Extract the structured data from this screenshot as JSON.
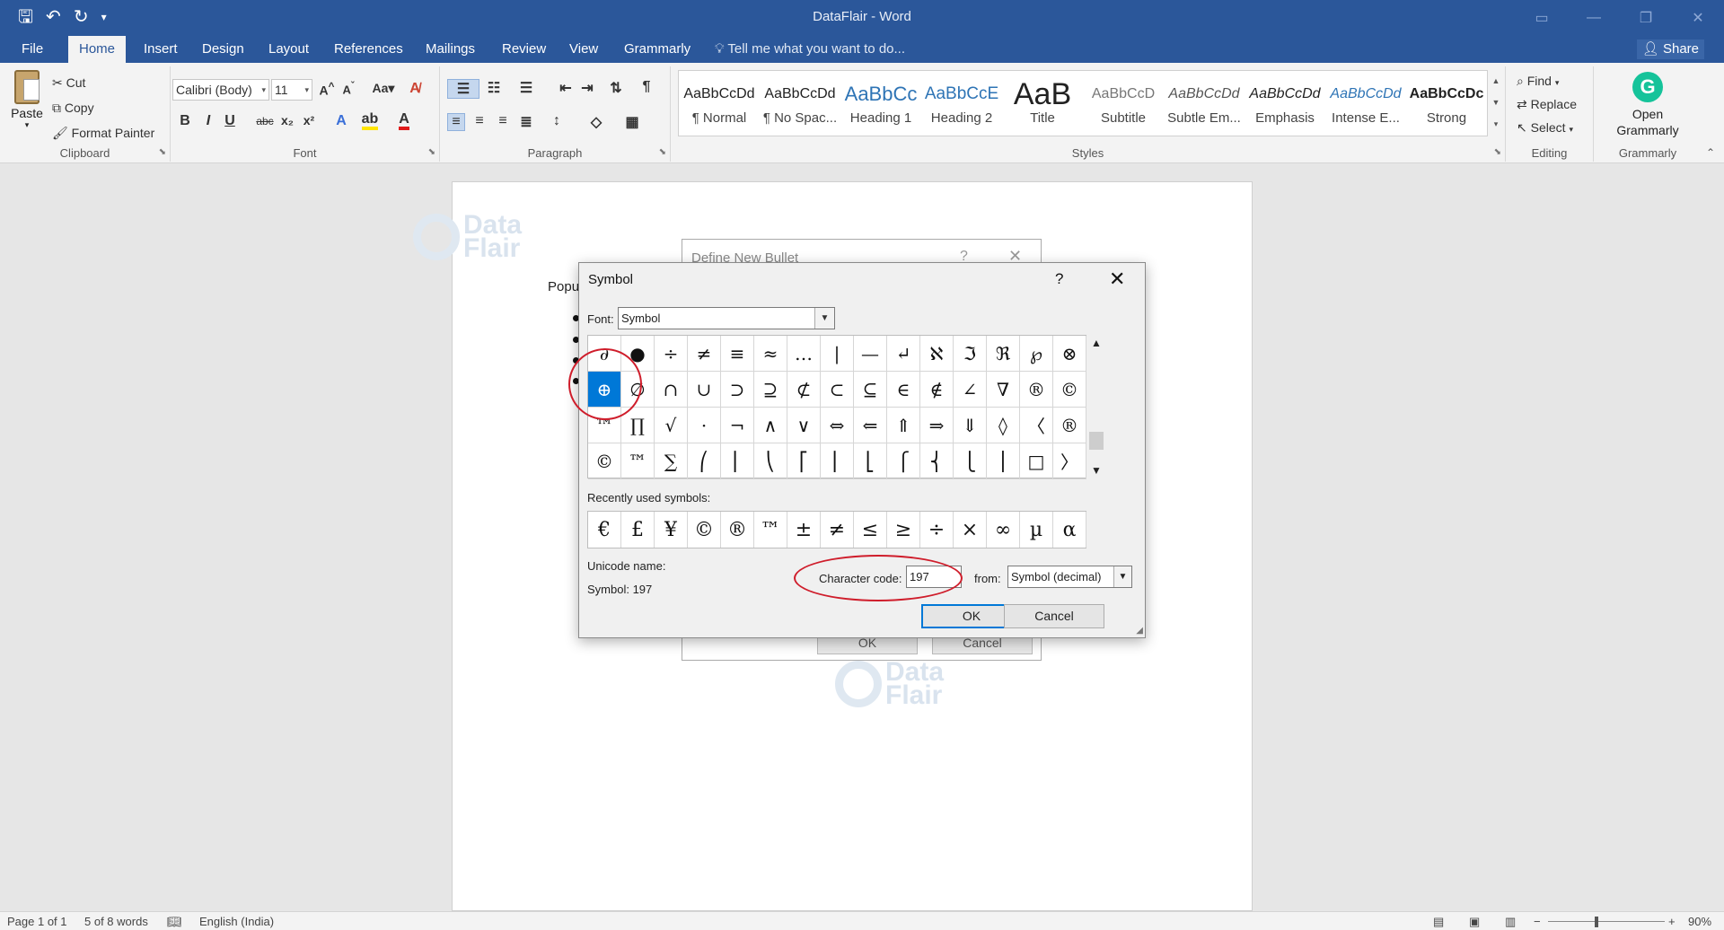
{
  "app": {
    "title": "DataFlair - Word"
  },
  "quick_access": [
    "save-icon",
    "undo-icon",
    "redo-icon",
    "customize-icon"
  ],
  "tabs": [
    "File",
    "Home",
    "Insert",
    "Design",
    "Layout",
    "References",
    "Mailings",
    "Review",
    "View",
    "Grammarly"
  ],
  "active_tab": "Home",
  "tell_me": "Tell me what you want to do...",
  "share": "Share",
  "ribbon": {
    "clipboard": {
      "paste": "Paste",
      "cut": "Cut",
      "copy": "Copy",
      "format_painter": "Format Painter",
      "label": "Clipboard"
    },
    "font": {
      "name": "Calibri (Body)",
      "size": "11",
      "label": "Font"
    },
    "paragraph": {
      "label": "Paragraph"
    },
    "styles": {
      "label": "Styles",
      "items": [
        {
          "preview": "AaBbCcDd",
          "name": "¶ Normal"
        },
        {
          "preview": "AaBbCcDd",
          "name": "¶ No Spac..."
        },
        {
          "preview": "AaBbCc",
          "name": "Heading 1"
        },
        {
          "preview": "AaBbCcE",
          "name": "Heading 2"
        },
        {
          "preview": "AaB",
          "name": "Title"
        },
        {
          "preview": "AaBbCcD",
          "name": "Subtitle"
        },
        {
          "preview": "AaBbCcDd",
          "name": "Subtle Em..."
        },
        {
          "preview": "AaBbCcDd",
          "name": "Emphasis"
        },
        {
          "preview": "AaBbCcDd",
          "name": "Intense E..."
        },
        {
          "preview": "AaBbCcDc",
          "name": "Strong"
        }
      ]
    },
    "editing": {
      "find": "Find",
      "replace": "Replace",
      "select": "Select",
      "label": "Editing"
    },
    "grammarly": {
      "open": "Open Grammarly",
      "label": "Grammarly"
    }
  },
  "document": {
    "text": "Popu"
  },
  "back_dialog": {
    "title": "Define New Bullet",
    "ok": "OK",
    "cancel": "Cancel"
  },
  "symbol_dialog": {
    "title": "Symbol",
    "help": "?",
    "close": "✕",
    "font_label": "Font:",
    "font_value": "Symbol",
    "grid": [
      [
        "∂",
        "●",
        "÷",
        "≠",
        "≡",
        "≈",
        "…",
        "|",
        "—",
        "↵",
        "ℵ",
        "ℑ",
        "ℜ",
        "℘",
        "⊗"
      ],
      [
        "⊕",
        "∅",
        "∩",
        "∪",
        "⊃",
        "⊇",
        "⊄",
        "⊂",
        "⊆",
        "∈",
        "∉",
        "∠",
        "∇",
        "®",
        "©"
      ],
      [
        "™",
        "∏",
        "√",
        "·",
        "¬",
        "∧",
        "∨",
        "⇔",
        "⇐",
        "⇑",
        "⇒",
        "⇓",
        "◊",
        "〈",
        "®"
      ],
      [
        "©",
        "™",
        "∑",
        "⎛",
        "⎜",
        "⎝",
        "⎡",
        "⎢",
        "⎣",
        "⎧",
        "⎨",
        "⎩",
        "⎪",
        "□",
        "〉"
      ]
    ],
    "selected": "⊕",
    "recent_label": "Recently used symbols:",
    "recent": [
      "€",
      "£",
      "¥",
      "©",
      "®",
      "™",
      "±",
      "≠",
      "≤",
      "≥",
      "÷",
      "×",
      "∞",
      "µ",
      "α"
    ],
    "unicode_name_label": "Unicode name:",
    "symbol_info": "Symbol: 197",
    "char_code_label": "Character code:",
    "char_code_value": "197",
    "from_label": "from:",
    "from_value": "Symbol (decimal)",
    "ok": "OK",
    "cancel": "Cancel"
  },
  "status": {
    "page": "Page 1 of 1",
    "words": "5 of 8 words",
    "language": "English (India)",
    "zoom": "90%"
  },
  "watermark": {
    "line1": "Data",
    "line2": "Flair"
  },
  "colors": {
    "accent": "#2b579a",
    "annotation": "#cf1d2b",
    "selection": "#0078d7"
  }
}
